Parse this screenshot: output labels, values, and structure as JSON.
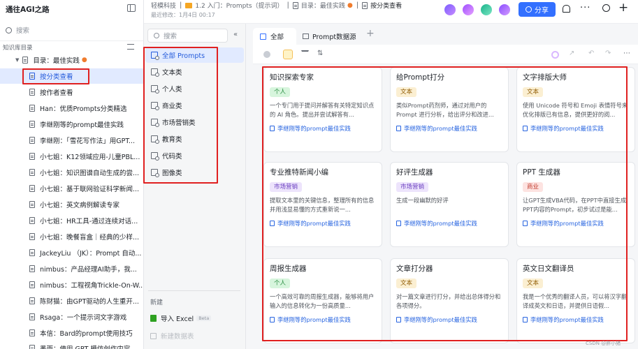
{
  "left": {
    "title": "通往AGI之路",
    "collapse_icon": "sidebar-collapse-icon",
    "search_placeholder": "搜索",
    "section_label": "知识库目录",
    "parent_item": "目录：最佳实践",
    "items": [
      "按分类查看",
      "按作者查看",
      "Han：优质Prompts分类精选",
      "李继刚等的prompt最佳实践",
      "李继刚：「雪花写作法」用GPT...",
      "小七姐：K12领域应用-儿童PBL...",
      "小七姐：知识图谱自动生成的尝...",
      "小七姐：基于联网验证科学新闻...",
      "小七姐：英文病例解读专家",
      "小七姐：HR工具-通过连续对话...",
      "小七姐：晚餐盲盒｜经典的少样...",
      "JackeyLiu （JK）：Prompt 自动...",
      "nimbus：产品经理AI助手，我...",
      "nimbus：工程视角Trickle-On-W...",
      "陈财猫：由GPT驱动的人生重开...",
      "Rsaga：一个提示词文字游戏",
      "本信：Bard的prompt使用技巧",
      "墨雨：使用 GPT 模仿创作内容"
    ]
  },
  "topbar": {
    "brand": "轻模科技",
    "crumb1": "1.2 入门：Prompts（提示词）",
    "crumb2": "目录：最佳实践",
    "crumb3": "按分类查看",
    "modified": "最近修改：1月4日 00:17",
    "share_label": "分享"
  },
  "pane2": {
    "search_placeholder": "搜索",
    "categories": [
      "全部 Prompts",
      "文本类",
      "个人类",
      "商业类",
      "市场营销类",
      "教育类",
      "代码类",
      "图像类"
    ],
    "new_label": "新建",
    "import_label": "导入 Excel",
    "beta": "Beta",
    "new_table_label": "新建数据表"
  },
  "tabs": {
    "all": "全部",
    "source": "Prompt数据源",
    "add": "+"
  },
  "cards": [
    {
      "title": "知识探索专家",
      "tag": "个人",
      "desc": "一个专门用于提问并解答有关特定知识点的 AI 角色。提出并尝试解答有...",
      "link": "李继刚等的prompt最佳实践"
    },
    {
      "title": "给Prompt打分",
      "tag": "文本",
      "desc": "类似Prompt药剂师，通过对用户的Prompt 进行分析，给出评分和改进...",
      "link": "李继刚等的prompt最佳实践"
    },
    {
      "title": "文字排版大师",
      "tag": "文本",
      "desc": "使用 Unicode 符号和 Emoji 表情符号来优化排版已有信息，提供更好的阅...",
      "link": "李继刚等的prompt最佳实践"
    },
    {
      "title": "专业推特新闻小编",
      "tag": "市场营销",
      "desc": "提取文本里的关键信息，整理所有的信息并用浅显易懂的方式重新说一...",
      "link": "李继刚等的prompt最佳实践"
    },
    {
      "title": "好评生成器",
      "tag": "市场营销",
      "desc": "生成一段幽默的好评",
      "link": "李继刚等的prompt最佳实践"
    },
    {
      "title": "PPT 生成器",
      "tag": "商业",
      "desc": "让GPT生成VBA代码，在PPT中直接生成PPT内容的Prompt，初步试过是能...",
      "link": "李继刚等的prompt最佳实践"
    },
    {
      "title": "周报生成器",
      "tag": "个人",
      "desc": "一个高效可靠的周报生成器，能够将用户输入的信息转化为一份高质量...",
      "link": "李继刚等的prompt最佳实践"
    },
    {
      "title": "文章打分器",
      "tag": "文本",
      "desc": "对一篇文章进行打分，并给出总体得分和各项得分。",
      "link": "李继刚等的prompt最佳实践"
    },
    {
      "title": "英文日文翻译员",
      "tag": "文本",
      "desc": "我是一个优秀的翻译人员，可以将汉字翻译成英文和日语，并提供日语假...",
      "link": "李继刚等的prompt最佳实践"
    }
  ],
  "colors": {
    "tag_personal_bg": "#d7f5dd",
    "tag_personal_fg": "#248a3d",
    "tag_text_bg": "#fbefd2",
    "tag_text_fg": "#8f5a00",
    "tag_market_bg": "#ede4fc",
    "tag_market_fg": "#6b3fc0",
    "tag_biz_bg": "#fde3e1",
    "tag_biz_fg": "#c0392b",
    "accent": "#3370ff"
  },
  "watermark": "CSDN @胖小猪"
}
